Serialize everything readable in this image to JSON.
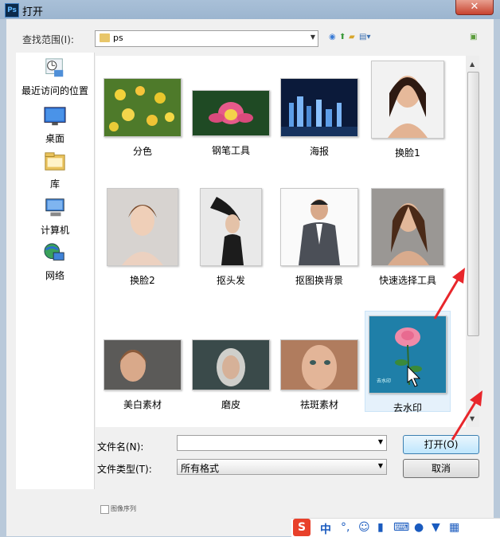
{
  "window": {
    "title": "打开",
    "app_icon_text": "Ps",
    "close_glyph": "✕"
  },
  "lookin": {
    "label": "查找范围(I):",
    "value": "ps"
  },
  "places": [
    {
      "label": "最近访问的位置",
      "icon": "recent-places-icon"
    },
    {
      "label": "桌面",
      "icon": "desktop-icon"
    },
    {
      "label": "库",
      "icon": "libraries-icon"
    },
    {
      "label": "计算机",
      "icon": "computer-icon"
    },
    {
      "label": "网络",
      "icon": "network-icon"
    }
  ],
  "files": [
    {
      "name": "分色"
    },
    {
      "name": "钢笔工具"
    },
    {
      "name": "海报"
    },
    {
      "name": "换脸1"
    },
    {
      "name": "换脸2"
    },
    {
      "name": "抠头发"
    },
    {
      "name": "抠图换背景"
    },
    {
      "name": "快速选择工具"
    },
    {
      "name": "美白素材"
    },
    {
      "name": "磨皮"
    },
    {
      "name": "祛斑素材"
    },
    {
      "name": "去水印",
      "selected": true,
      "watermark": "去水印"
    }
  ],
  "form": {
    "filename_label": "文件名(N):",
    "filename_value": "",
    "filetype_label": "文件类型(T):",
    "filetype_value": "所有格式"
  },
  "buttons": {
    "open": "打开(O)",
    "cancel": "取消"
  },
  "options": {
    "sequence_label": "图像序列"
  },
  "ime": {
    "logo": "S",
    "mode": "中",
    "punct": "°,",
    "emoji": "☺",
    "mic": "🎤",
    "keyboard": "⌨"
  },
  "colors": {
    "arrow": "#e8262b",
    "selection": "#e5f1fb",
    "default_button": "#bee6fd"
  }
}
